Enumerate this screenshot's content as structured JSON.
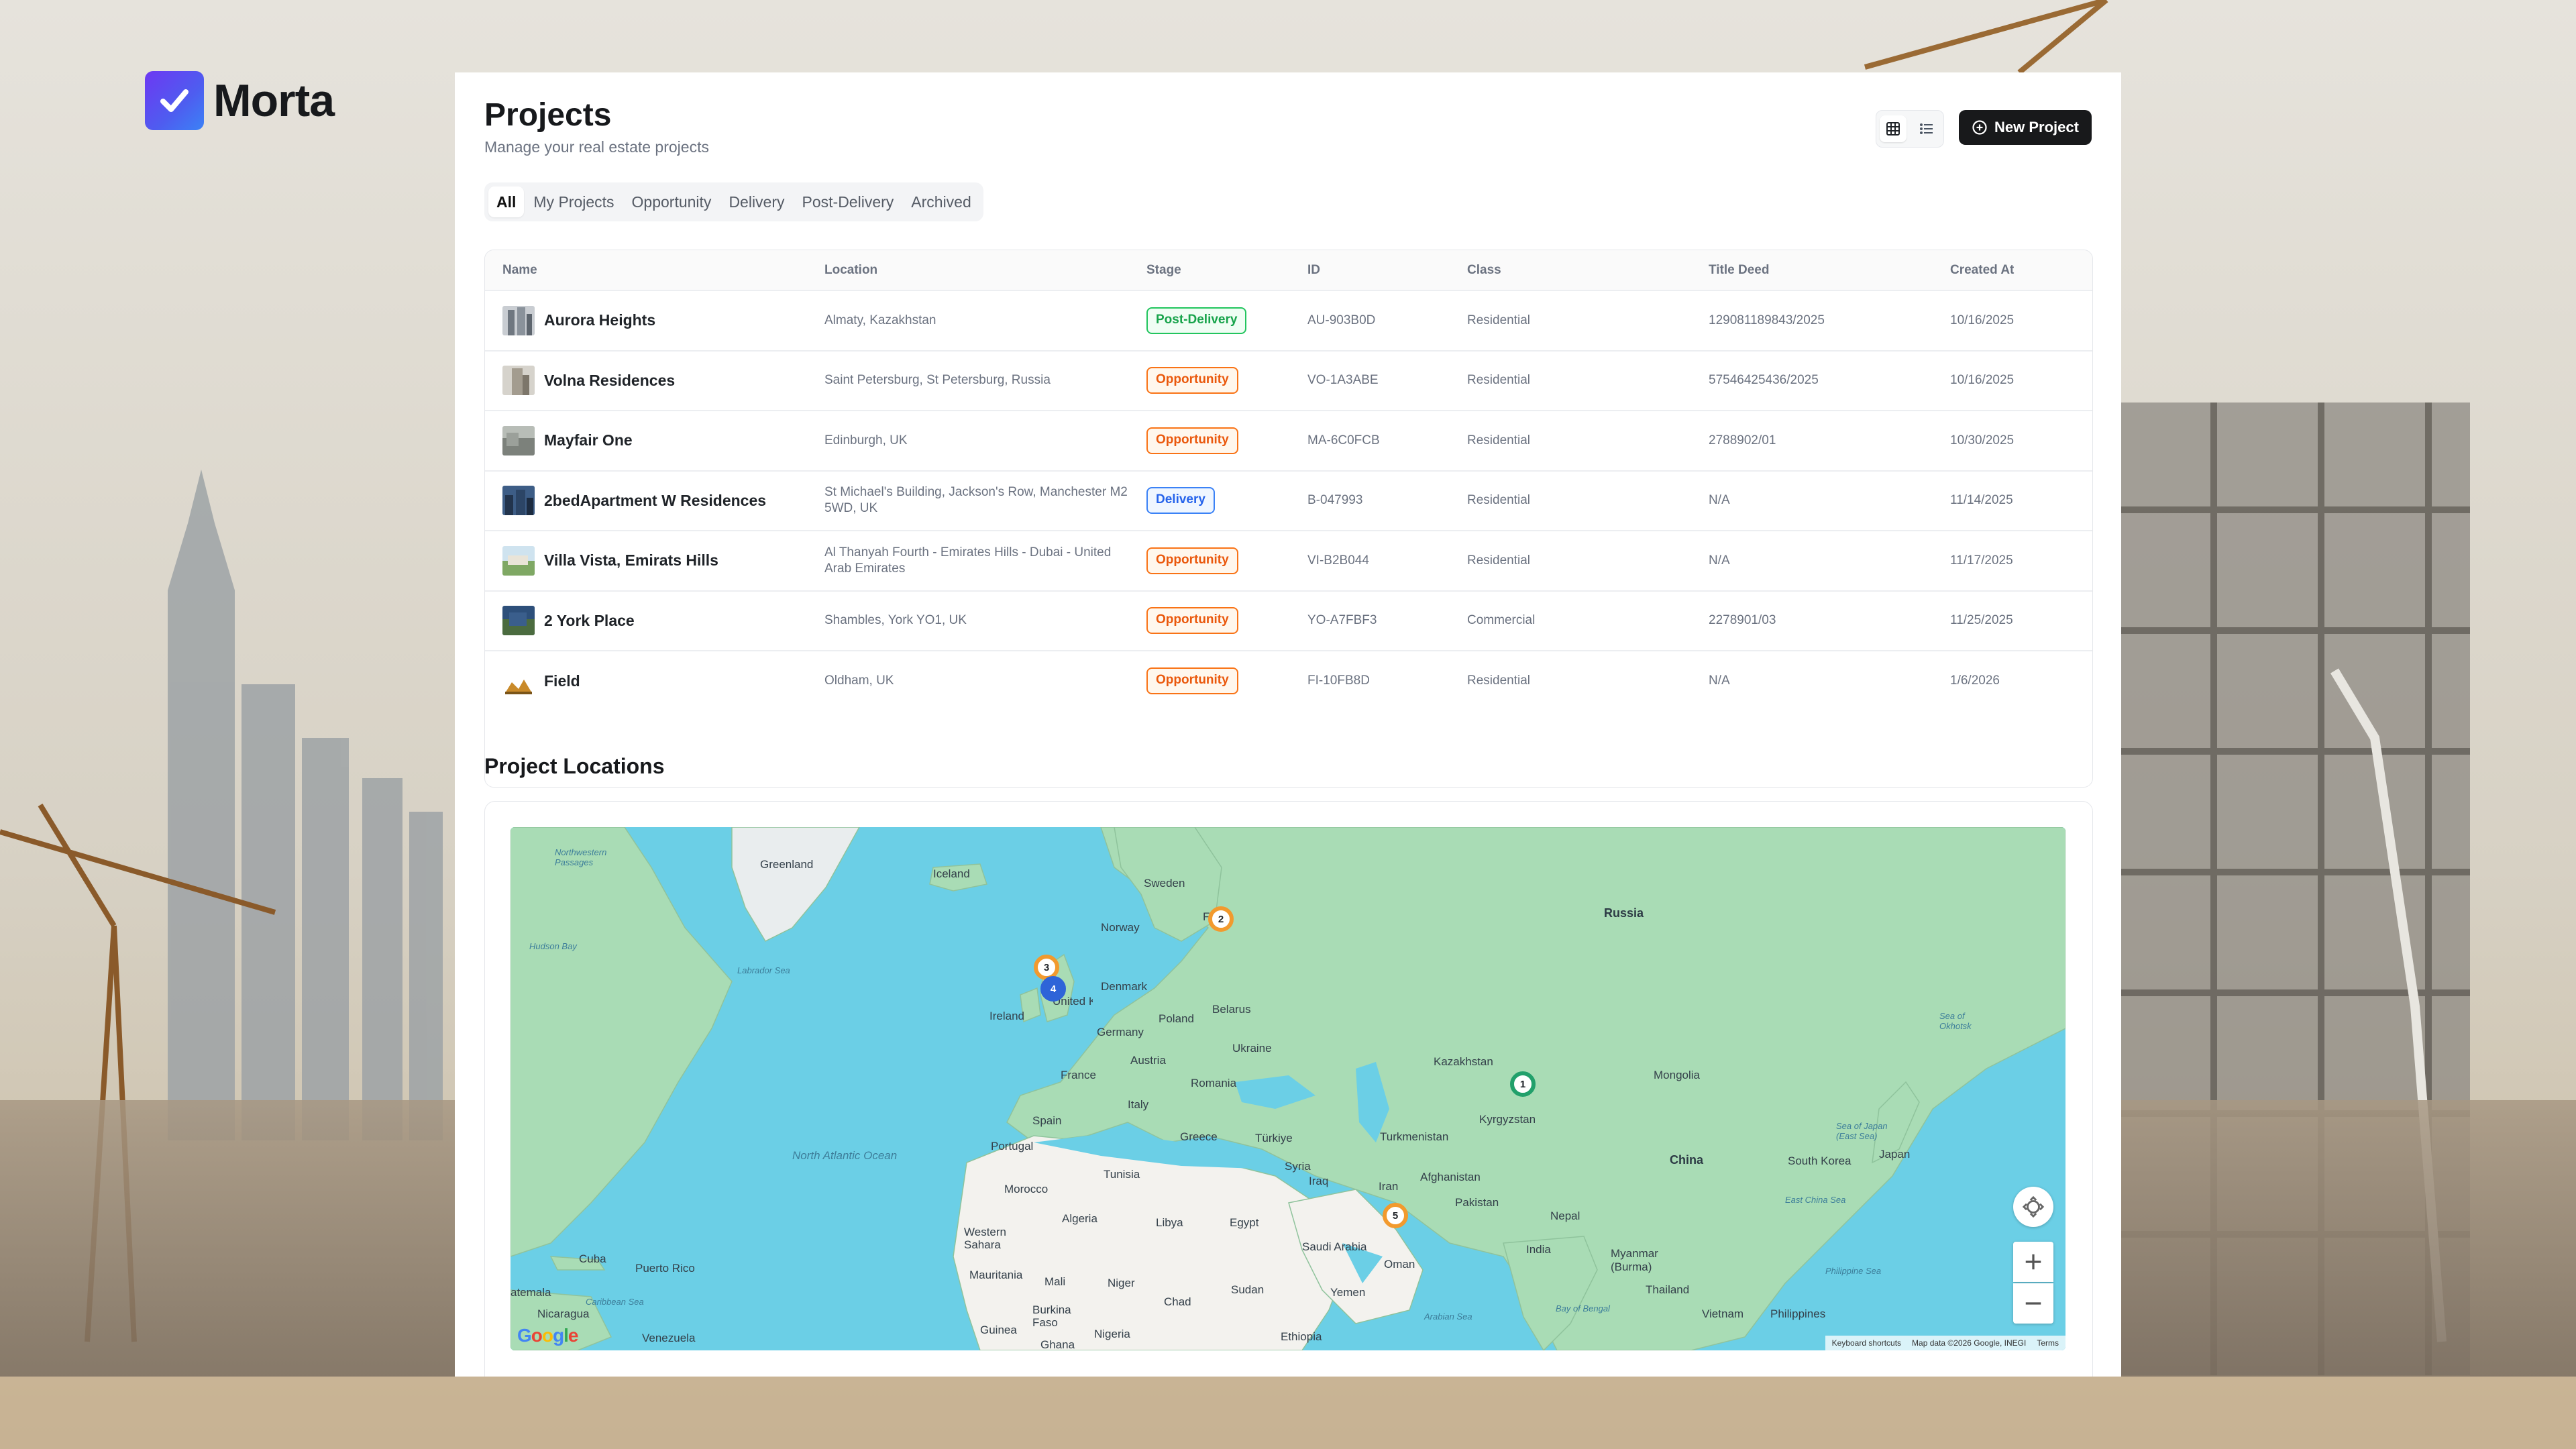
{
  "brand": {
    "name": "Morta",
    "accent": "#5b4bf0"
  },
  "header": {
    "title": "Projects",
    "subtitle": "Manage your real estate projects",
    "view_toggle": {
      "grid_icon": "grid-icon",
      "list_icon": "list-icon",
      "active": "grid"
    },
    "new_project_label": "New Project",
    "new_project_icon": "plus-circle-icon"
  },
  "filters": {
    "tabs": [
      "All",
      "My Projects",
      "Opportunity",
      "Delivery",
      "Post-Delivery",
      "Archived"
    ],
    "active": "All"
  },
  "table": {
    "columns": [
      "Name",
      "Location",
      "Stage",
      "ID",
      "Class",
      "Title Deed",
      "Created At"
    ],
    "rows": [
      {
        "name": "Aurora Heights",
        "location": "Almaty, Kazakhstan",
        "stage": "Post-Delivery",
        "id": "AU-903B0D",
        "class": "Residential",
        "title_deed": "129081189843/2025",
        "created_at": "10/16/2025"
      },
      {
        "name": "Volna Residences",
        "location": "Saint Petersburg, St Petersburg, Russia",
        "stage": "Opportunity",
        "id": "VO-1A3ABE",
        "class": "Residential",
        "title_deed": "57546425436/2025",
        "created_at": "10/16/2025"
      },
      {
        "name": "Mayfair One",
        "location": "Edinburgh, UK",
        "stage": "Opportunity",
        "id": "MA-6C0FCB",
        "class": "Residential",
        "title_deed": "2788902/01",
        "created_at": "10/30/2025"
      },
      {
        "name": "2bedApartment W Residences",
        "location": "St Michael's Building, Jackson's Row, Manchester M2 5WD, UK",
        "stage": "Delivery",
        "id": "B-047993",
        "class": "Residential",
        "title_deed": "N/A",
        "created_at": "11/14/2025"
      },
      {
        "name": "Villa Vista, Emirats Hills",
        "location": "Al Thanyah Fourth - Emirates Hills - Dubai - United Arab Emirates",
        "stage": "Opportunity",
        "id": "VI-B2B044",
        "class": "Residential",
        "title_deed": "N/A",
        "created_at": "11/17/2025"
      },
      {
        "name": "2 York Place",
        "location": "Shambles, York YO1, UK",
        "stage": "Opportunity",
        "id": "YO-A7FBF3",
        "class": "Commercial",
        "title_deed": "2278901/03",
        "created_at": "11/25/2025"
      },
      {
        "name": "Field",
        "location": "Oldham, UK",
        "stage": "Opportunity",
        "id": "FI-10FB8D",
        "class": "Residential",
        "title_deed": "N/A",
        "created_at": "1/6/2026"
      }
    ]
  },
  "map": {
    "title": "Project Locations",
    "labels": {
      "greenland": "Greenland",
      "iceland": "Iceland",
      "sweden": "Sweden",
      "finland": "Finla",
      "norway": "Norway",
      "russia": "Russia",
      "denmark": "Denmark",
      "ireland": "Ireland",
      "united_kingdom": "United Kingdom",
      "belarus": "Belarus",
      "poland": "Poland",
      "germany": "Germany",
      "ukraine": "Ukraine",
      "austria": "Austria",
      "france": "France",
      "romania": "Romania",
      "italy": "Italy",
      "spain": "Spain",
      "portugal": "Portugal",
      "greece": "Greece",
      "turkiye": "Türkiye",
      "kazakhstan": "Kazakhstan",
      "mongolia": "Mongolia",
      "kyrgyzstan": "Kyrgyzstan",
      "turkmenistan": "Turkmenistan",
      "syria": "Syria",
      "iraq": "Iraq",
      "iran": "Iran",
      "afghanistan": "Afghanistan",
      "pakistan": "Pakistan",
      "nepal": "Nepal",
      "china": "China",
      "south_korea": "South Korea",
      "japan": "Japan",
      "india": "India",
      "myanmar": "Myanmar (Burma)",
      "thailand": "Thailand",
      "vietnam": "Vietnam",
      "philippines": "Philippines",
      "tunisia": "Tunisia",
      "morocco": "Morocco",
      "algeria": "Algeria",
      "libya": "Libya",
      "egypt": "Egypt",
      "western_sahara": "Western Sahara",
      "mauritania": "Mauritania",
      "mali": "Mali",
      "niger": "Niger",
      "chad": "Chad",
      "sudan": "Sudan",
      "saudi_arabia": "Saudi Arabia",
      "oman": "Oman",
      "yemen": "Yemen",
      "burkina_faso": "Burkina Faso",
      "guinea": "Guinea",
      "ghana": "Ghana",
      "nigeria": "Nigeria",
      "ethiopia": "Ethiopia",
      "cuba": "Cuba",
      "puerto_rico": "Puerto Rico",
      "guatemala": "atemala",
      "nicaragua": "Nicaragua",
      "venezuela": "Venezuela",
      "north_atlantic": "North Atlantic Ocean",
      "hudson_bay": "Hudson Bay",
      "labrador_sea": "Labrador Sea",
      "northwestern_passages": "Northwestern Passages",
      "caribbean_sea": "Caribbean Sea",
      "arabian_sea": "Arabian Sea",
      "bay_of_bengal": "Bay of Bengal",
      "east_china_sea": "East China Sea",
      "sea_of_japan": "Sea of Japan (East Sea)",
      "sea_of_okhotsk": "Sea of Okhotsk",
      "philippine_sea": "Philippine Sea"
    },
    "clusters": [
      {
        "count": "3",
        "color": "orange"
      },
      {
        "count": "4",
        "color": "blue"
      },
      {
        "count": "2",
        "color": "orange"
      },
      {
        "count": "1",
        "color": "green"
      },
      {
        "count": "5",
        "color": "orange"
      }
    ],
    "attribution": {
      "shortcuts": "Keyboard shortcuts",
      "data": "Map data ©2026 Google, INEGI",
      "terms": "Terms"
    },
    "google_logo": "Google"
  },
  "colors": {
    "post_delivery": "#16a34a",
    "opportunity": "#ea580c",
    "delivery": "#2563eb",
    "ocean": "#6bcfe6",
    "land": "#a9dcb5"
  }
}
